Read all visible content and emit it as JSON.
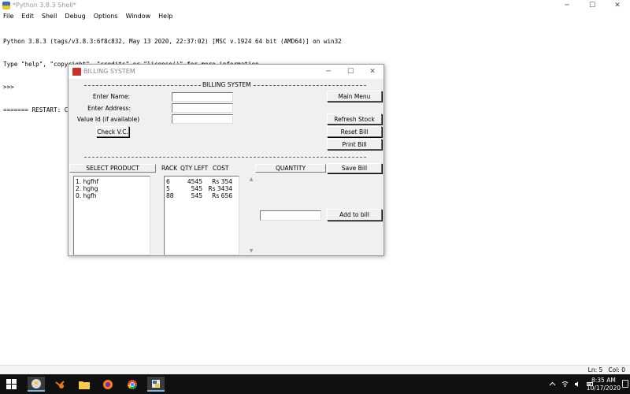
{
  "shell": {
    "title": "*Python 3.8.3 Shell*",
    "menu": [
      "File",
      "Edit",
      "Shell",
      "Debug",
      "Options",
      "Window",
      "Help"
    ],
    "lines": [
      "Python 3.8.3 (tags/v3.8.3:6f8c832, May 13 2020, 22:37:02) [MSC v.1924 64 bit (AMD64)] on win32",
      "Type \"help\", \"copyright\", \"credits\" or \"license()\" for more information.",
      ">>> ",
      "======= RESTART: C:\\Users\\Aditya\\Desktop\\Pharmacy-Management\\CAPS_PMS.py ======="
    ],
    "status": "Ln: 5   Col: 0"
  },
  "window_controls": {
    "minimize": "─",
    "maximize": "☐",
    "close": "✕"
  },
  "billing": {
    "title": "BILLING SYSTEM",
    "section_label": "BILLING SYSTEM",
    "labels": {
      "name": "Enter Name:",
      "address": "Enter Address:",
      "value_id": "Value Id (if available)"
    },
    "fields": {
      "name": "",
      "address": "",
      "value_id": "",
      "quantity": ""
    },
    "buttons": {
      "check_vc": "Check V.C.",
      "main_menu": "Main Menu",
      "refresh_stock": "Refresh Stock",
      "reset_bill": "Reset Bill",
      "print_bill": "Print Bill",
      "save_bill": "Save Bill",
      "add_to_bill": "Add to bill"
    },
    "headers": {
      "select_product": "SELECT PRODUCT",
      "rack": "RACK",
      "qty_left": "QTY LEFT",
      "cost": "COST",
      "quantity": "QUANTITY"
    },
    "products": [
      "1. hgfhf",
      "2. hghg",
      "0. hgfh"
    ],
    "stock": [
      {
        "rack": "6",
        "qty": "4545",
        "cost": "Rs 354"
      },
      {
        "rack": "5",
        "qty": "545",
        "cost": "Rs 3434"
      },
      {
        "rack": "88",
        "qty": "545",
        "cost": "Rs 656"
      }
    ]
  },
  "taskbar": {
    "time": "8:35 AM",
    "date": "10/17/2020",
    "apps": [
      "idle-python-icon",
      "blender-icon",
      "folder-icon",
      "firefox-icon",
      "chrome-icon",
      "python-shell-icon"
    ]
  },
  "colors": {
    "taskbar": "#101010",
    "accent": "#76b9ed",
    "window_bg": "#f0f0f0"
  }
}
